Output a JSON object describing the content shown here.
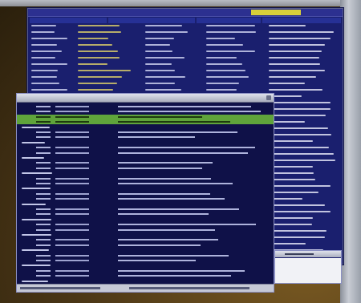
{
  "back_window": {
    "accent_color": "#d8cf3a",
    "background_color": "#1a1f6e"
  },
  "front_window": {
    "title": "",
    "highlight_color": "#5fa43b",
    "background_color": "#0f1148"
  },
  "mini_window": {
    "title": ""
  }
}
